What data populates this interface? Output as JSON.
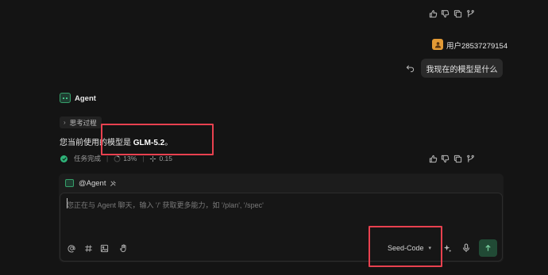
{
  "top_actions": [
    "thumbs-up-icon",
    "thumbs-down-icon",
    "copy-icon",
    "branch-icon"
  ],
  "user": {
    "name": "用户28537279154",
    "message": "我现在的模型是什么"
  },
  "agent": {
    "name": "Agent",
    "thinking_label": "思考过程",
    "answer_prefix": "您当前使用的模型是 ",
    "answer_model": "GLM-5.2",
    "answer_suffix": "。",
    "status_label": "任务完成",
    "usage_percent": "13%",
    "cost": "0.15"
  },
  "composer": {
    "agent_tag": "@Agent",
    "placeholder": "您正在与 Agent 聊天，输入 '/' 获取更多能力，如 '/plan', '/spec'",
    "model": "Seed-Code"
  },
  "colors": {
    "accent_green": "#2fb47a",
    "highlight_red": "#e8414f",
    "avatar_orange": "#e39a35"
  }
}
